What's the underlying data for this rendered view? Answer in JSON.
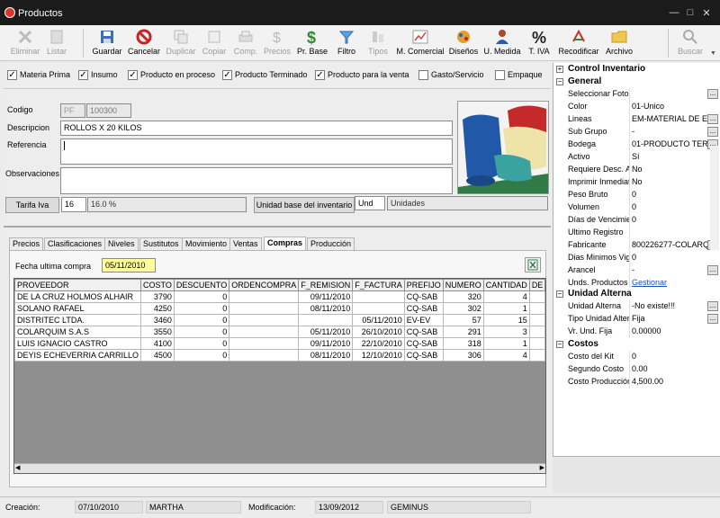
{
  "window": {
    "title": "Productos"
  },
  "toolbar": {
    "eliminar": "Eliminar",
    "listar": "Listar",
    "guardar": "Guardar",
    "cancelar": "Cancelar",
    "duplicar": "Duplicar",
    "copiar": "Copiar",
    "comp": "Comp.",
    "precios": "Precios",
    "pr_base": "Pr. Base",
    "filtro": "Filtro",
    "tipos": "Tipos",
    "m_comercial": "M. Comercial",
    "disenos": "Diseños",
    "u_medida": "U. Medida",
    "t_iva": "T. IVA",
    "recodificar": "Recodificar",
    "archivo": "Archivo",
    "buscar": "Buscar"
  },
  "checkboxes": {
    "materia_prima": "Materia Prima",
    "insumo": "Insumo",
    "producto_proceso": "Producto en proceso",
    "producto_terminado": "Producto Terminado",
    "producto_venta": "Producto para la venta",
    "gasto_servicio": "Gasto/Servicio",
    "empaque": "Empaque"
  },
  "form": {
    "codigo_label": "Codigo",
    "codigo_prefix": "PF",
    "codigo_value": "100300",
    "descripcion_label": "Descripcion",
    "descripcion_value": "ROLLOS X 20 KILOS",
    "referencia_label": "Referencia",
    "observaciones_label": "Observaciones",
    "tarifa_button": "Tarifa Iva",
    "tarifa_code": "16",
    "tarifa_pct": "16.0 %",
    "unidad_button": "Unidad base del inventario",
    "unidad_code": "Und",
    "unidad_name": "Unidades"
  },
  "tabs": [
    "Precios",
    "Clasificaciones",
    "Niveles",
    "Sustitutos",
    "Movimiento",
    "Ventas",
    "Compras",
    "Producción"
  ],
  "compras": {
    "fecha_label": "Fecha ultima compra",
    "fecha_value": "05/11/2010",
    "headers": [
      "PROVEEDOR",
      "COSTO",
      "DESCUENTO",
      "ORDENCOMPRA",
      "F_REMISION",
      "F_FACTURA",
      "PREFIJO",
      "NUMERO",
      "CANTIDAD",
      "DE"
    ],
    "rows": [
      [
        "DE LA CRUZ HOLMOS ALHAIR",
        "3790",
        "0",
        "",
        "09/11/2010",
        "",
        "CQ-SAB",
        "320",
        "4",
        ""
      ],
      [
        "SOLANO RAFAEL",
        "4250",
        "0",
        "",
        "08/11/2010",
        "",
        "CQ-SAB",
        "302",
        "1",
        ""
      ],
      [
        "DISTRITEC LTDA.",
        "3460",
        "0",
        "",
        "",
        "05/11/2010",
        "EV-EV",
        "57",
        "15",
        ""
      ],
      [
        "COLARQUIM S.A.S",
        "3550",
        "0",
        "",
        "05/11/2010",
        "26/10/2010",
        "CQ-SAB",
        "291",
        "3",
        ""
      ],
      [
        "LUIS IGNACIO CASTRO",
        "4100",
        "0",
        "",
        "09/11/2010",
        "22/10/2010",
        "CQ-SAB",
        "318",
        "1",
        ""
      ],
      [
        "DEYIS ECHEVERRIA CARRILLO",
        "4500",
        "0",
        "",
        "08/11/2010",
        "12/10/2010",
        "CQ-SAB",
        "306",
        "4",
        ""
      ]
    ]
  },
  "properties": {
    "control_inventario": "Control Inventario",
    "general": "General",
    "general_rows": [
      [
        "Seleccionar Foto",
        ""
      ],
      [
        "Color",
        "01-Unico"
      ],
      [
        "Lineas",
        "EM-MATERIAL DE E"
      ],
      [
        "Sub Grupo",
        "-"
      ],
      [
        "Bodega",
        "01-PRODUCTO TER"
      ],
      [
        "Activo",
        "Sí"
      ],
      [
        "Requiere Desc. A",
        "No"
      ],
      [
        "Imprimir Inmediat",
        "No"
      ],
      [
        "Peso Bruto",
        "0"
      ],
      [
        "Volumen",
        "0"
      ],
      [
        "Días de Vencimie",
        "0"
      ],
      [
        "Ultimo Registro",
        ""
      ],
      [
        "Fabricante",
        "800226277-COLARQ"
      ],
      [
        "Dias Minimos Vig",
        "0"
      ],
      [
        "Arancel",
        "-"
      ],
      [
        "Unds. Productos",
        "Gestionar"
      ]
    ],
    "unidad_alterna": "Unidad Alterna",
    "unidad_rows": [
      [
        "Unidad Alterna",
        "-No existe!!!"
      ],
      [
        "Tipo Unidad Alter",
        "Fija"
      ],
      [
        "Vr. Und. Fija",
        "0.00000"
      ]
    ],
    "costos": "Costos",
    "costos_rows": [
      [
        "Costo del Kit",
        "0"
      ],
      [
        "Segundo Costo",
        "0.00"
      ],
      [
        "Costo Producción",
        "4,500.00"
      ]
    ]
  },
  "status": {
    "creacion_label": "Creación:",
    "creacion_date": "07/10/2010",
    "creacion_user": "MARTHA",
    "modificacion_label": "Modificación:",
    "modificacion_date": "13/09/2012",
    "modificacion_user": "GEMINUS"
  },
  "colors": {
    "accent_red": "#cc2222",
    "fecha_highlight": "#ffff99",
    "link": "#1a4fb5"
  }
}
